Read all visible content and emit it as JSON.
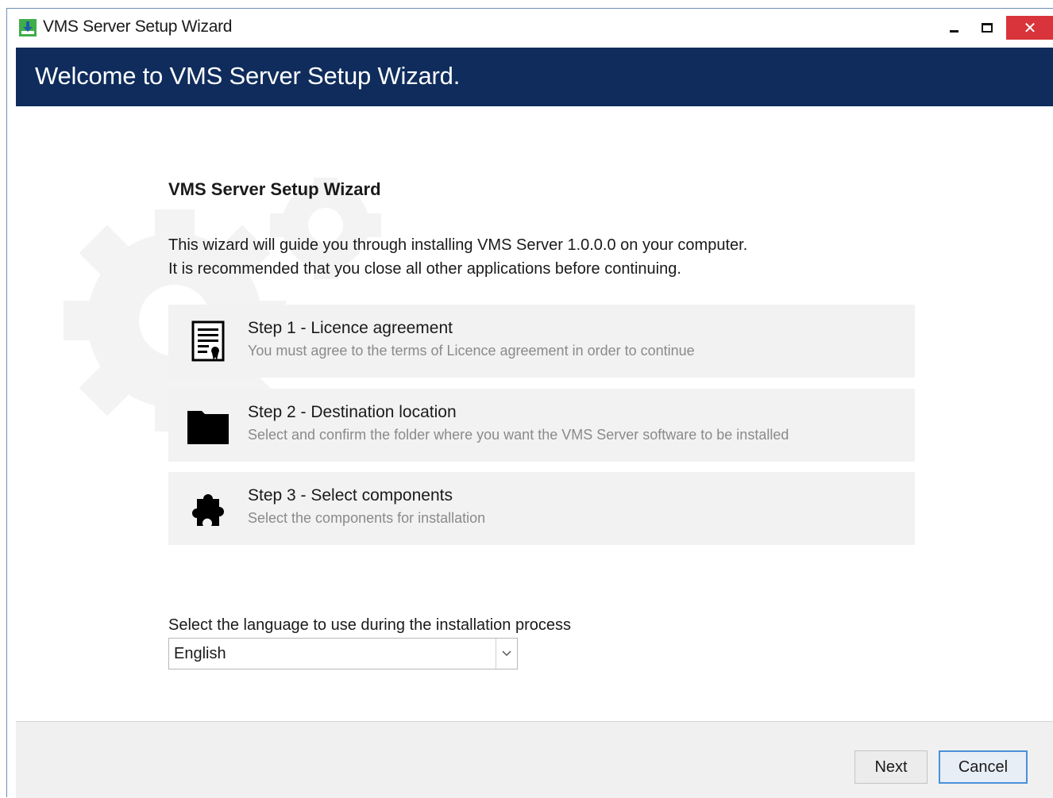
{
  "window": {
    "title": "VMS Server Setup Wizard",
    "close_glyph": "✕"
  },
  "header": {
    "title": "Welcome to VMS Server Setup Wizard.",
    "background_color": "#0f2c5c"
  },
  "main": {
    "section_title": "VMS Server Setup Wizard",
    "intro_lines": [
      "This wizard will guide you through installing VMS Server 1.0.0.0 on your computer.",
      "It is recommended that you close all other applications before continuing."
    ],
    "steps": [
      {
        "title": "Step 1 - Licence agreement",
        "description": "You must agree to the terms of Licence agreement in order to continue",
        "icon": "document-certificate-icon"
      },
      {
        "title": "Step 2 - Destination location",
        "description": "Select and confirm the folder where you want the VMS Server software to be installed",
        "icon": "folder-icon"
      },
      {
        "title": "Step 3 - Select components",
        "description": "Select the components for installation",
        "icon": "puzzle-piece-icon"
      }
    ],
    "language": {
      "label": "Select the language to use during the installation process",
      "selected": "English"
    }
  },
  "footer": {
    "next_label": "Next",
    "cancel_label": "Cancel"
  },
  "colors": {
    "accent": "#0f2c5c",
    "close_button": "#d9343b",
    "focus_border": "#4a90d9"
  }
}
